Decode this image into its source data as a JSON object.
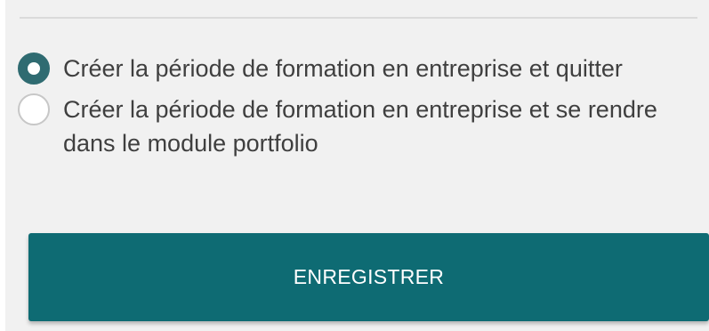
{
  "colors": {
    "accent": "#0e6b73",
    "radio_checked": "#2f6b71",
    "panel_background": "#f1f1f1",
    "text": "#3f3f3f"
  },
  "options": [
    {
      "label": "Créer la période de formation en entreprise et quitter",
      "checked": true
    },
    {
      "label": "Créer la période de formation en entreprise et se rendre dans le module portfolio",
      "checked": false
    }
  ],
  "save_button": {
    "label": "ENREGISTRER"
  }
}
